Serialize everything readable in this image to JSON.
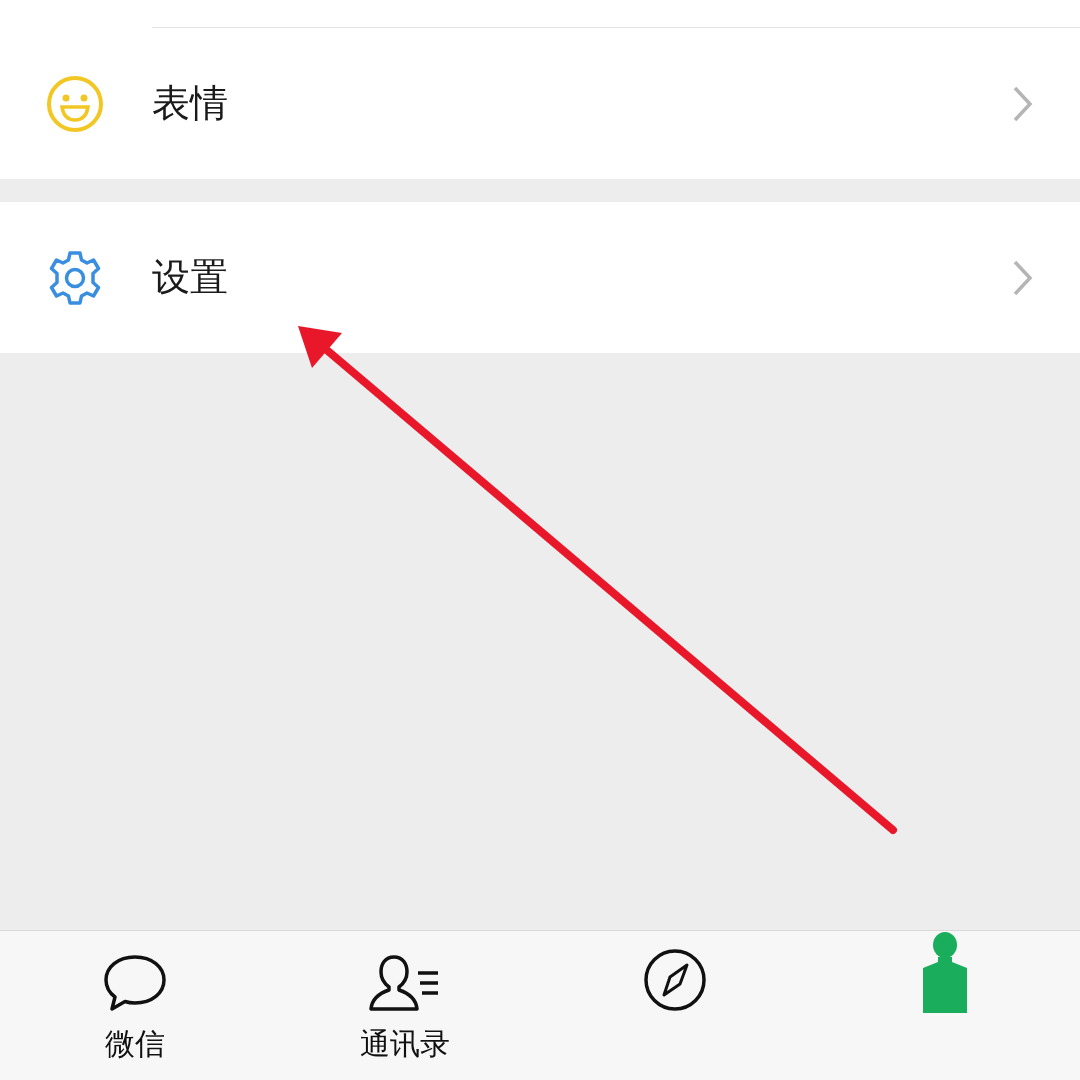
{
  "menu_groups": [
    {
      "items": [
        {
          "label": "表情",
          "kind": "emoji"
        }
      ]
    },
    {
      "items": [
        {
          "label": "设置",
          "kind": "settings"
        }
      ]
    }
  ],
  "tab_bar": [
    {
      "label": "微信",
      "kind": "chats",
      "selected": false
    },
    {
      "label": "通讯录",
      "kind": "contacts",
      "selected": false
    },
    {
      "kind": "discover",
      "selected": false
    },
    {
      "kind": "me",
      "selected": true
    }
  ]
}
